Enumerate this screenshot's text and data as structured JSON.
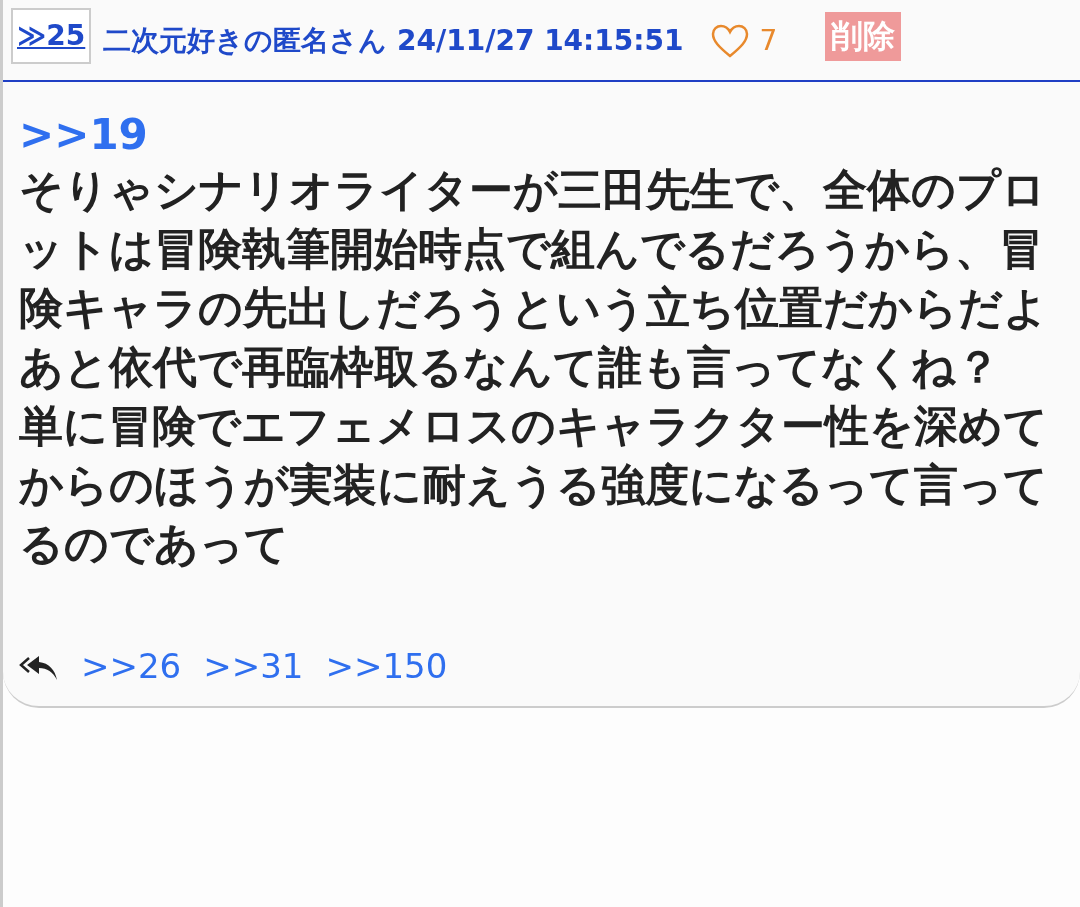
{
  "post": {
    "number": "≫25",
    "author": "二次元好きの匿名さん",
    "timestamp": "24/11/27 14:15:51",
    "likes": "7",
    "liked": false,
    "delete_label": "削除",
    "anchor": ">>19",
    "paragraphs": [
      "そりゃシナリオライターが三田先生で、全体のプロットは冒険執筆開始時点で組んでるだろうから、冒険キャラの先出しだろうという立ち位置だからだよ",
      "あと依代で再臨枠取るなんて誰も言ってなくね？",
      "単に冒険でエフェメロスのキャラクター性を深めてからのほうが実装に耐えうる強度になるって言ってるのであって"
    ],
    "replies": [
      ">>26",
      ">>31",
      ">>150"
    ]
  }
}
